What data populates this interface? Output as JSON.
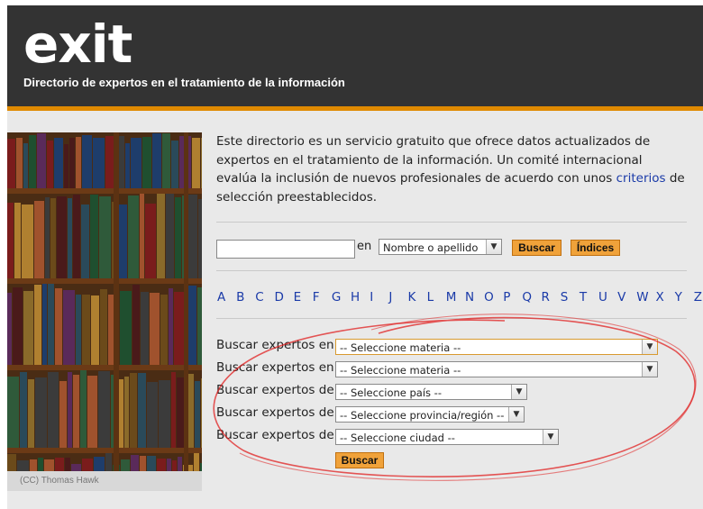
{
  "header": {
    "logo": "exit",
    "subtitle": "Directorio de expertos en el tratamiento de la información"
  },
  "photo": {
    "credit": "(CC) Thomas Hawk"
  },
  "intro": {
    "text_before_link": "Este directorio es un servicio gratuito que ofrece datos actualizados de expertos en el tratamiento de la información. Un comité internacional evalúa la inclusión de nuevos profesionales de acuerdo con unos ",
    "link_label": "criterios",
    "text_after_link": " de selección preestablecidos."
  },
  "search": {
    "input_value": "",
    "in_label": "en",
    "field_select": "Nombre o apellido",
    "search_button": "Buscar",
    "indexes_button": "Índices"
  },
  "letters": [
    "A",
    "B",
    "C",
    "D",
    "E",
    "F",
    "G",
    "H",
    "I",
    "J",
    "K",
    "L",
    "M",
    "N",
    "O",
    "P",
    "Q",
    "R",
    "S",
    "T",
    "U",
    "V",
    "W",
    "X",
    "Y",
    "Z"
  ],
  "filters": [
    {
      "label": "Buscar expertos en",
      "value": "-- Seleccione materia --"
    },
    {
      "label": "Buscar expertos en",
      "value": "-- Seleccione materia --"
    },
    {
      "label": "Buscar expertos de",
      "value": "-- Seleccione país --"
    },
    {
      "label": "Buscar expertos de",
      "value": "-- Seleccione provincia/región --"
    },
    {
      "label": "Buscar expertos de",
      "value": "-- Seleccione ciudad --"
    }
  ],
  "filters_button": "Buscar",
  "colors": {
    "header_bg": "#333333",
    "accent": "#e08a00",
    "link": "#1a3aa8",
    "button": "#f0a23a",
    "annotation": "#e02020"
  }
}
